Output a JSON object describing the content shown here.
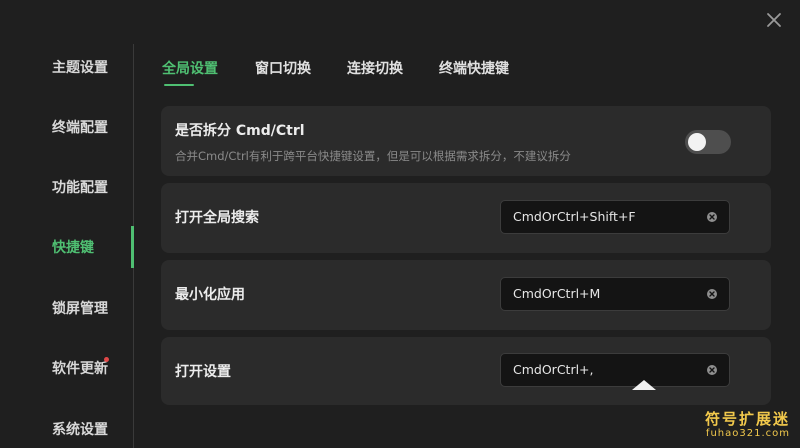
{
  "window": {
    "close_icon": "close-icon"
  },
  "sidebar": {
    "items": [
      {
        "label": "主题设置"
      },
      {
        "label": "终端配置"
      },
      {
        "label": "功能配置"
      },
      {
        "label": "快捷键",
        "active": true
      },
      {
        "label": "锁屏管理"
      },
      {
        "label": "软件更新",
        "badge": "red-dot"
      },
      {
        "label": "系统设置"
      }
    ]
  },
  "tabs": [
    {
      "label": "全局设置",
      "active": true
    },
    {
      "label": "窗口切换"
    },
    {
      "label": "连接切换"
    },
    {
      "label": "终端快捷键"
    }
  ],
  "settings": {
    "split_cmd": {
      "title": "是否拆分 Cmd/Ctrl",
      "description": "合并Cmd/Ctrl有利于跨平台快捷键设置，但是可以根据需求拆分，不建议拆分",
      "enabled": false
    },
    "shortcuts": [
      {
        "label": "打开全局搜索",
        "value": "CmdOrCtrl+Shift+F"
      },
      {
        "label": "最小化应用",
        "value": "CmdOrCtrl+M"
      },
      {
        "label": "打开设置",
        "value": "CmdOrCtrl+,"
      }
    ]
  },
  "watermark": {
    "title": "符号扩展迷",
    "url": "fuhao321.com"
  },
  "colors": {
    "accent": "#4fbf72",
    "background": "#1f1f1f",
    "card": "#2b2b2b",
    "badge": "#e04848"
  }
}
